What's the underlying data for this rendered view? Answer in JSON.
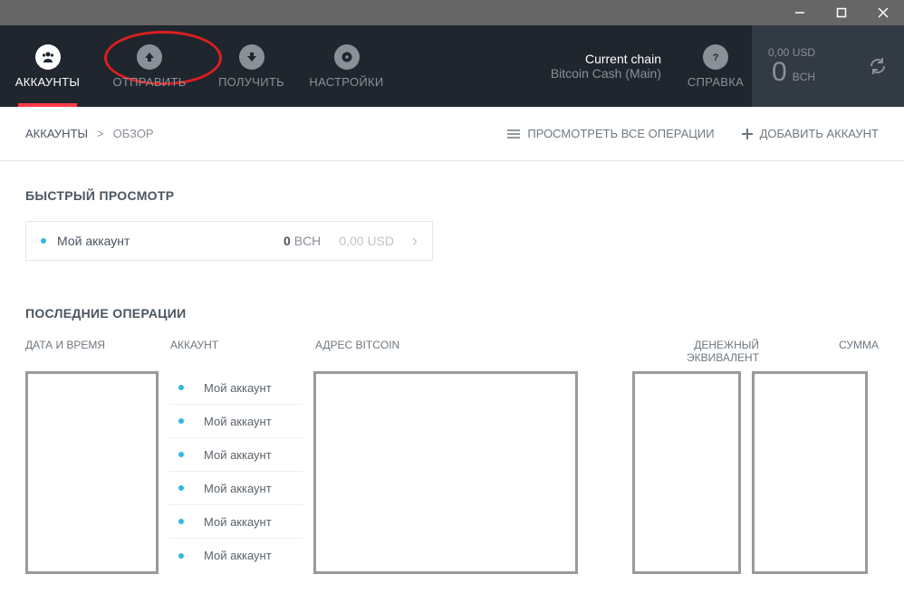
{
  "nav": {
    "items": [
      {
        "label": "АККАУНТЫ",
        "icon": "users"
      },
      {
        "label": "ОТПРАВИТЬ",
        "icon": "arrow-up"
      },
      {
        "label": "ПОЛУЧИТЬ",
        "icon": "arrow-down"
      },
      {
        "label": "НАСТРОЙКИ",
        "icon": "gear"
      }
    ],
    "help": "СПРАВКА"
  },
  "chain": {
    "label": "Current chain",
    "name": "Bitcoin Cash (Main)"
  },
  "balance": {
    "usd": "0,00 USD",
    "amount_num": "0",
    "amount_cur": "BCH"
  },
  "breadcrumb": {
    "root": "АККАУНТЫ",
    "sep": ">",
    "current": "ОБЗОР"
  },
  "subactions": {
    "view_all": "ПРОСМОТРЕТЬ ВСЕ ОПЕРАЦИИ",
    "add_account": "ДОБАВИТЬ АККАУНТ"
  },
  "sections": {
    "quickview": "БЫСТРЫЙ ПРОСМОТР",
    "last_ops": "ПОСЛЕДНИЕ ОПЕРАЦИИ"
  },
  "quickview": {
    "name": "Мой аккаунт",
    "bch_num": "0",
    "bch_cur": "BCH",
    "usd": "0,00 USD"
  },
  "txn_columns": {
    "date": "ДАТА И ВРЕМЯ",
    "account": "АККАУНТ",
    "address": "АДРЕС BITCOIN",
    "equiv": "ДЕНЕЖНЫЙ ЭКВИВАЛЕНТ",
    "sum": "СУММА"
  },
  "txn_rows": [
    {
      "account": "Мой аккаунт"
    },
    {
      "account": "Мой аккаунт"
    },
    {
      "account": "Мой аккаунт"
    },
    {
      "account": "Мой аккаунт"
    },
    {
      "account": "Мой аккаунт"
    },
    {
      "account": "Мой аккаунт"
    }
  ]
}
